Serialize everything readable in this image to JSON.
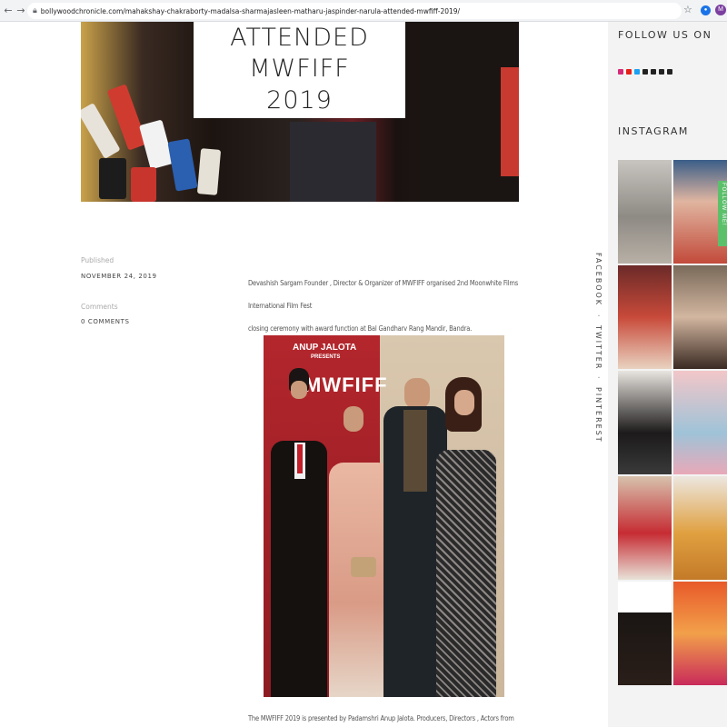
{
  "browser": {
    "url": "bollywoodchronicle.com/mahakshay-chakraborty-madalsa-sharmajasleen-matharu-jaspinder-narula-attended-mwfiff-2019/",
    "profile_initial": "M"
  },
  "hero": {
    "title_line1": "ATTENDED MWFIFF",
    "title_line2": "2019"
  },
  "meta": {
    "published_label": "Published",
    "published_value": "NOVEMBER 24, 2019",
    "comments_label": "Comments",
    "comments_value": "0 COMMENTS"
  },
  "article": {
    "paragraph1_line1": "Devashish Sargam Founder , Director & Organizer of MWFIFF organised 2nd Moonwhite Films International Film Fest",
    "paragraph1_line2": "closing ceremony with award function at Bal Gandharv Rang Mandir, Bandra.",
    "paragraph2_line1": "The MWFIFF 2019 is presented by Padamshri Anup Jalota. Producers, Directors , Actors from different short films attended"
  },
  "photo": {
    "poster_line1": "ANUP JALOTA",
    "poster_line2": "PRESENTS",
    "poster_logo": "MWFIFF"
  },
  "share": {
    "facebook": "FACEBOOK",
    "twitter": "TWITTER",
    "pinterest": "PINTEREST",
    "separator": "·"
  },
  "sidebar": {
    "follow_heading": "FOLLOW US ON",
    "instagram_heading": "INSTAGRAM",
    "follow_tab": "FOLLOW ME!"
  },
  "colors": {
    "accent": "#5cc06b",
    "sidebar_bg": "#f3f3f3"
  }
}
